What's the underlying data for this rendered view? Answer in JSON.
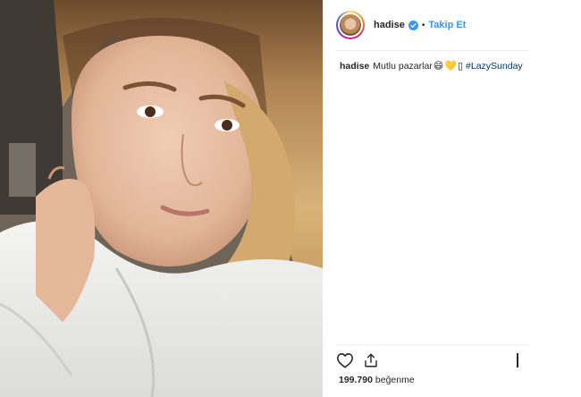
{
  "post": {
    "image_alt_subject": "",
    "author": {
      "username": "hadise",
      "verified": true,
      "separator": "•",
      "follow_label": "Takip Et"
    },
    "caption": {
      "username": "hadise",
      "text": "Mutlu pazarlar",
      "emojis": [
        "😄",
        "💛",
        "▯"
      ],
      "hashtag": "#LazySunday"
    },
    "actions": {
      "like_icon": "heart-icon",
      "share_icon": "share-icon",
      "save_icon": "bookmark-icon"
    },
    "likes": {
      "count": "199.790",
      "label": "beğenme"
    }
  },
  "colors": {
    "link": "#3897f0",
    "hashtag": "#003569",
    "text": "#262626",
    "divider": "#efefef"
  }
}
